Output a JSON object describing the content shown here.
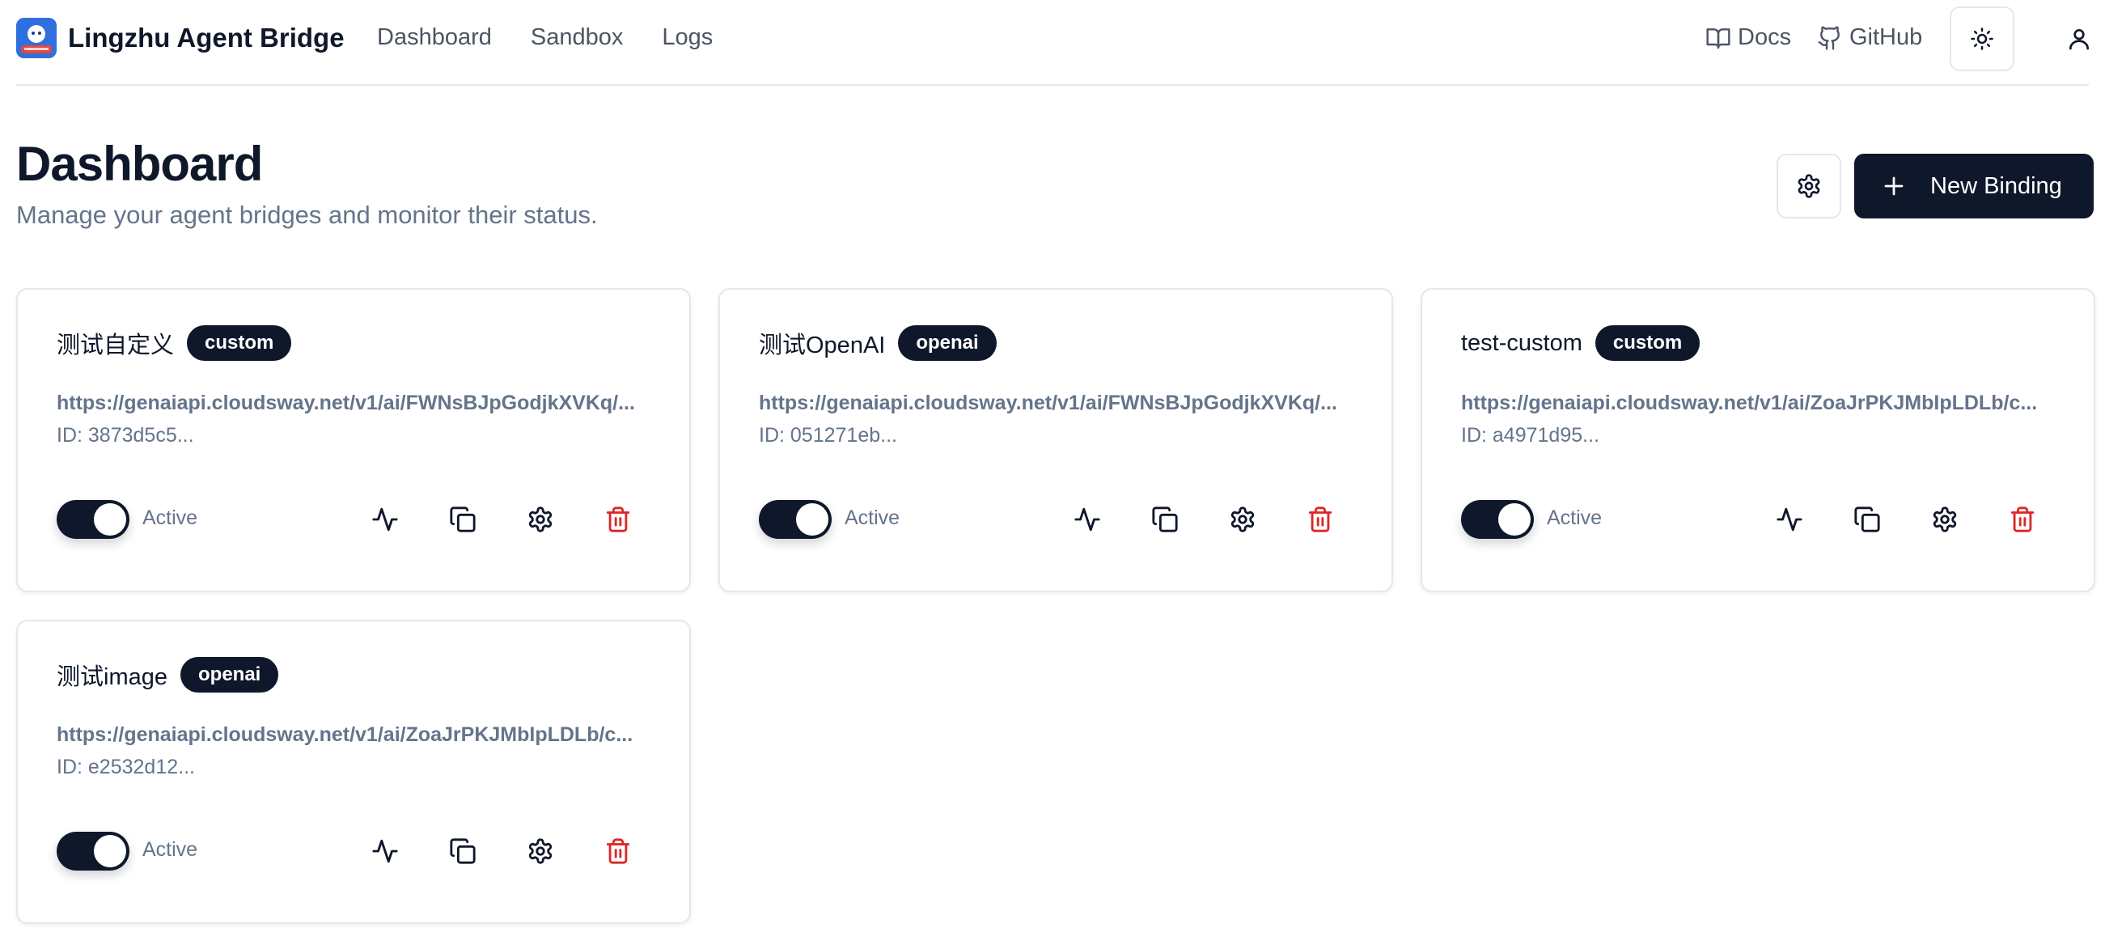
{
  "header": {
    "brand": "Lingzhu Agent Bridge",
    "nav": [
      "Dashboard",
      "Sandbox",
      "Logs"
    ],
    "docs_label": "Docs",
    "github_label": "GitHub",
    "icons": {
      "theme": "sun-icon",
      "user": "user-icon"
    }
  },
  "page": {
    "title": "Dashboard",
    "subtitle": "Manage your agent bridges and monitor their status.",
    "new_binding_label": "New Binding"
  },
  "cards": [
    {
      "name": "测试自定义",
      "type": "custom",
      "url": "https://genaiapi.cloudsway.net/v1/ai/FWNsBJpGodjkXVKq/...",
      "id": "ID: 3873d5c5...",
      "status": "Active"
    },
    {
      "name": "测试OpenAI",
      "type": "openai",
      "url": "https://genaiapi.cloudsway.net/v1/ai/FWNsBJpGodjkXVKq/...",
      "id": "ID: 051271eb...",
      "status": "Active"
    },
    {
      "name": "test-custom",
      "type": "custom",
      "url": "https://genaiapi.cloudsway.net/v1/ai/ZoaJrPKJMbIpLDLb/c...",
      "id": "ID: a4971d95...",
      "status": "Active"
    },
    {
      "name": "测试image",
      "type": "openai",
      "url": "https://genaiapi.cloudsway.net/v1/ai/ZoaJrPKJMbIpLDLb/c...",
      "id": "ID: e2532d12...",
      "status": "Active"
    }
  ],
  "colors": {
    "primary": "#0f172a",
    "muted": "#64748b",
    "danger": "#dc2626",
    "border": "#e5e7eb"
  }
}
